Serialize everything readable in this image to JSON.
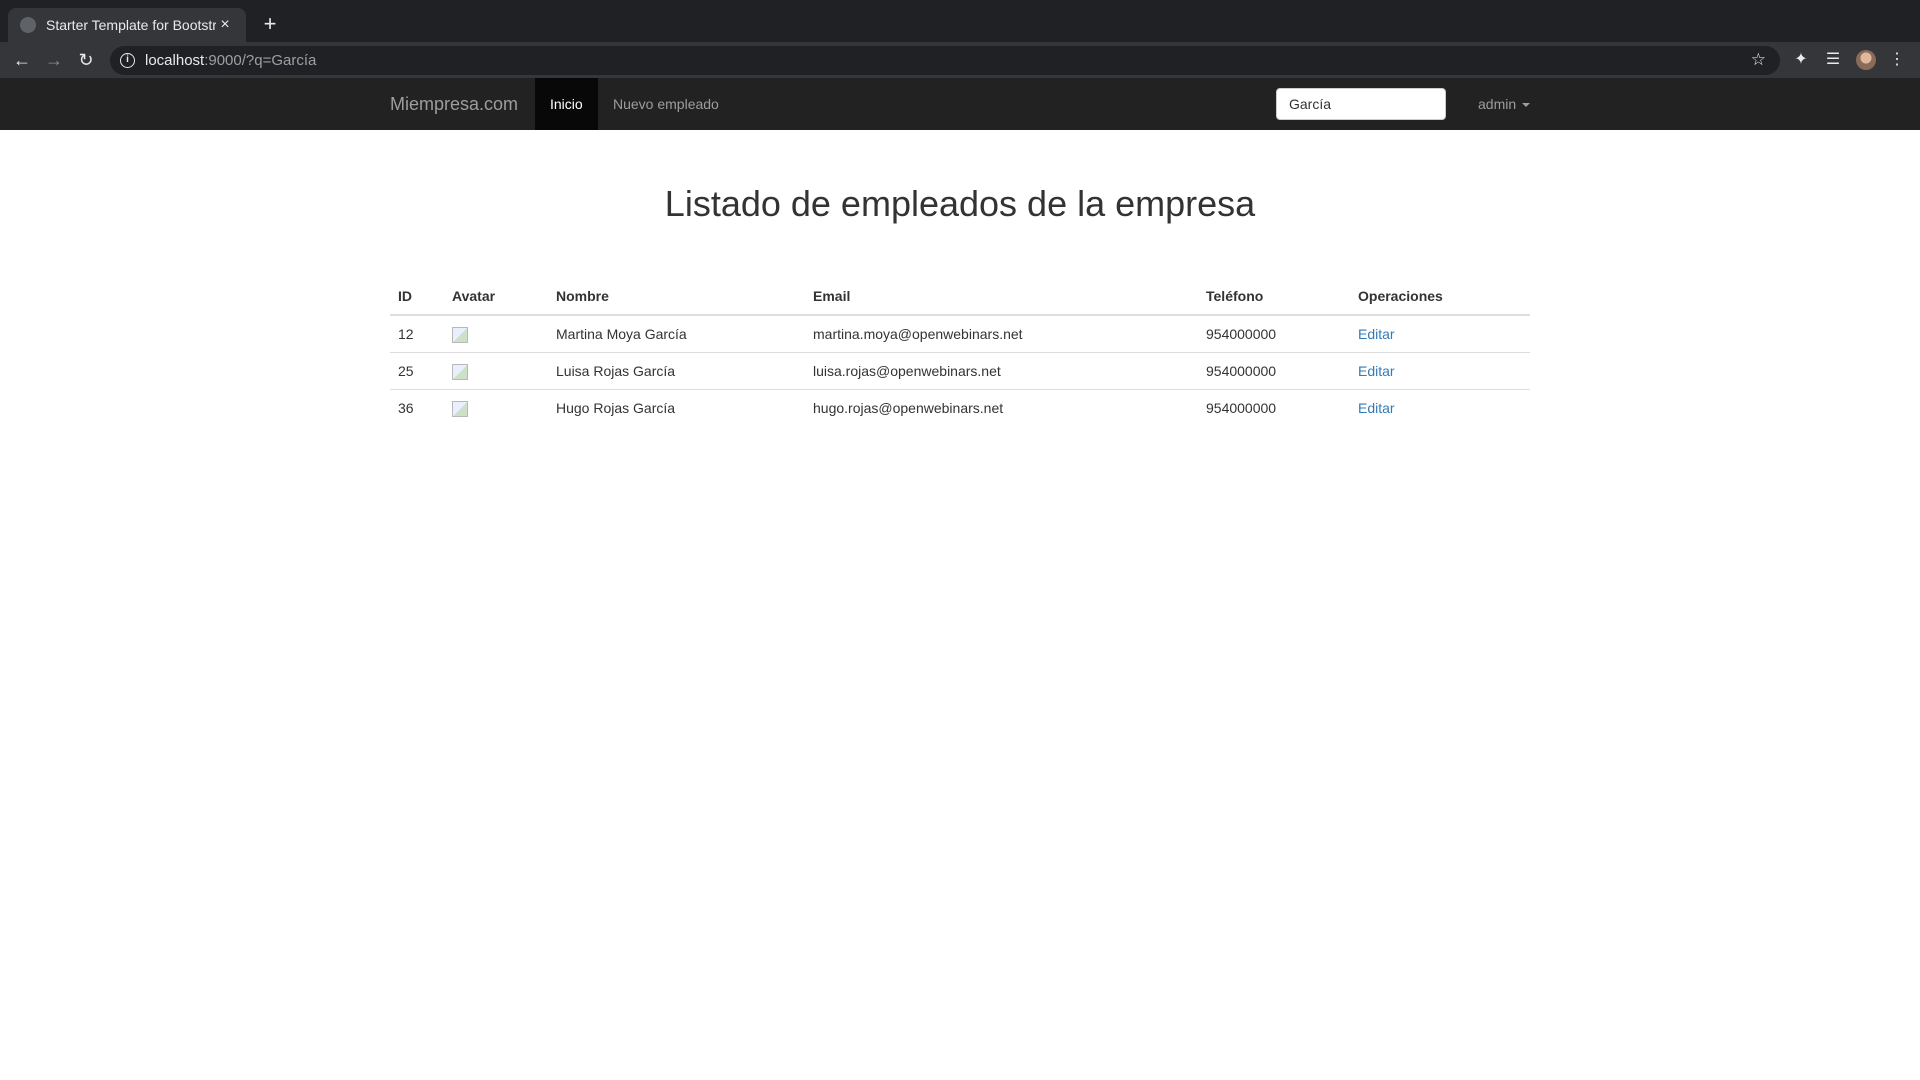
{
  "browser": {
    "tab_title": "Starter Template for Bootstrap",
    "tab_close": "×",
    "new_tab": "+",
    "url_host": "localhost",
    "url_rest": ":9000/?q=García"
  },
  "navbar": {
    "brand": "Miempresa.com",
    "links": [
      {
        "label": "Inicio",
        "active": true
      },
      {
        "label": "Nuevo empleado",
        "active": false
      }
    ],
    "search_value": "García",
    "user": "admin"
  },
  "main": {
    "title": "Listado de empleados de la empresa",
    "table": {
      "headers": [
        "ID",
        "Avatar",
        "Nombre",
        "Email",
        "Teléfono",
        "Operaciones"
      ],
      "rows": [
        {
          "id": "12",
          "name": "Martina Moya García",
          "email": "martina.moya@openwebinars.net",
          "phone": "954000000",
          "action": "Editar"
        },
        {
          "id": "25",
          "name": "Luisa Rojas García",
          "email": "luisa.rojas@openwebinars.net",
          "phone": "954000000",
          "action": "Editar"
        },
        {
          "id": "36",
          "name": "Hugo Rojas García",
          "email": "hugo.rojas@openwebinars.net",
          "phone": "954000000",
          "action": "Editar"
        }
      ]
    }
  },
  "colors": {
    "navbar_bg": "#222222",
    "active_link_bg": "#080808",
    "link": "#337ab7"
  }
}
